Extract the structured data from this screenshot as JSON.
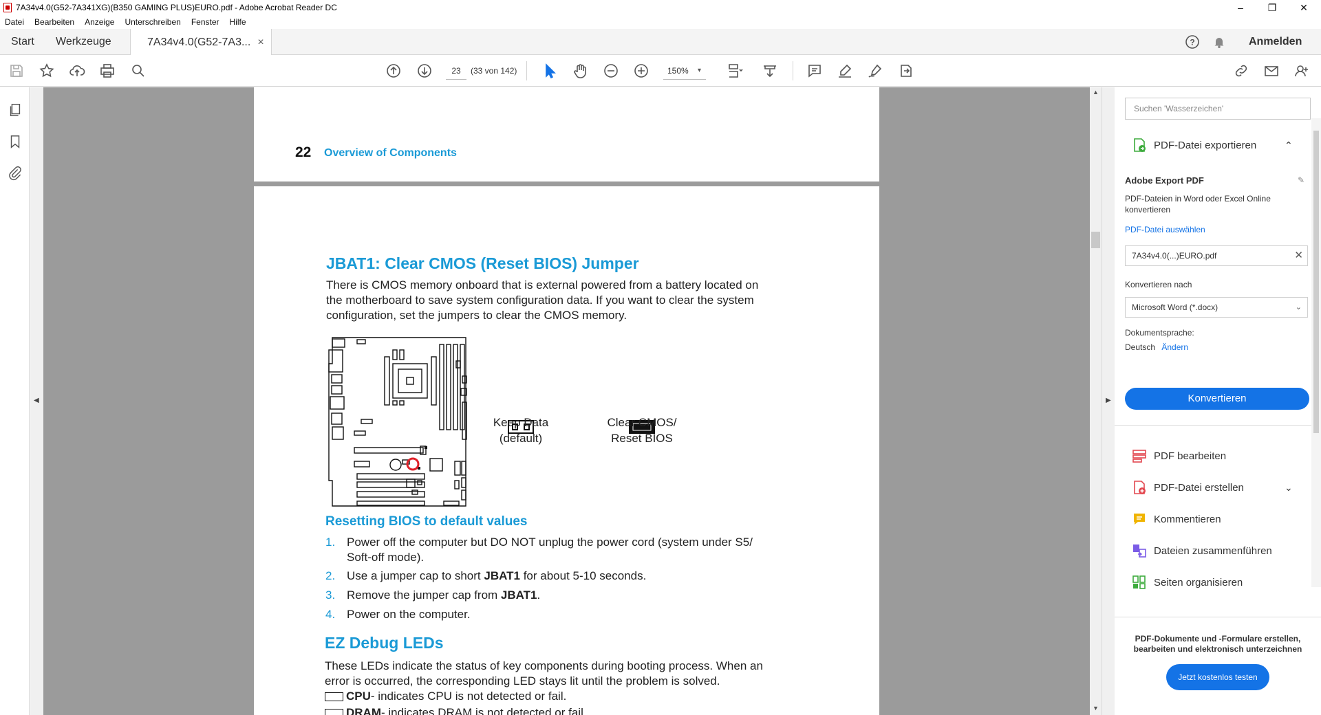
{
  "window": {
    "title": "7A34v4.0(G52-7A341XG)(B350 GAMING PLUS)EURO.pdf - Adobe Acrobat Reader DC"
  },
  "menu": [
    "Datei",
    "Bearbeiten",
    "Anzeige",
    "Unterschreiben",
    "Fenster",
    "Hilfe"
  ],
  "tabs": {
    "home": "Start",
    "tools": "Werkzeuge",
    "document": "7A34v4.0(G52-7A3...",
    "signin": "Anmelden"
  },
  "toolbar": {
    "page_current": "23",
    "page_count": "(33 von 142)",
    "zoom": "150%"
  },
  "document": {
    "page_number": "22",
    "header_title": "Overview of Components",
    "jbat_heading": "JBAT1: Clear CMOS (Reset BIOS) Jumper",
    "jbat_para_lines": [
      "There is CMOS memory onboard that is external powered from a battery located on",
      "the motherboard to save system configuration data. If you want to clear the system",
      "configuration, set the jumpers to clear the CMOS memory."
    ],
    "keep_data_line1": "Keep Data",
    "keep_data_line2": "(default)",
    "clear_cmos_line1": "Clear CMOS/",
    "clear_cmos_line2": "Reset BIOS",
    "reset_heading": "Resetting BIOS to default values",
    "steps": [
      {
        "n": "1.",
        "line1": "Power off the computer but DO NOT unplug the power cord (system under S5/",
        "line2": "Soft-off mode)."
      },
      {
        "n": "2.",
        "pre": "Use a jumper cap to short ",
        "bold": "JBAT1",
        "post": " for about 5-10 seconds."
      },
      {
        "n": "3.",
        "pre": "Remove the jumper cap from ",
        "bold": "JBAT1",
        "post": "."
      },
      {
        "n": "4.",
        "pre": "Power on the computer.",
        "bold": "",
        "post": ""
      }
    ],
    "ez_heading": "EZ Debug LEDs",
    "ez_para_lines": [
      "These LEDs indicate the status of key components during booting process. When an",
      "error is occurred, the corresponding LED stays lit until the problem is solved."
    ],
    "led_cpu_bold": "CPU",
    "led_cpu_text": " - indicates CPU is not detected or fail.",
    "led_dram_bold": "DRAM",
    "led_dram_text": " - indicates DRAM is not detected or fail."
  },
  "panel": {
    "search_placeholder": "Suchen 'Wasserzeichen'",
    "export_title": "PDF-Datei exportieren",
    "adobe_export": "Adobe Export PDF",
    "export_desc_line1": "PDF-Dateien in Word oder Excel Online",
    "export_desc_line2": "konvertieren",
    "select_file": "PDF-Datei auswählen",
    "file_name": "7A34v4.0(...)EURO.pdf",
    "convert_to": "Konvertieren nach",
    "format": "Microsoft Word (*.docx)",
    "doc_lang": "Dokumentsprache:",
    "lang": "Deutsch",
    "change": "Ändern",
    "convert_btn": "Konvertieren",
    "tools": [
      {
        "label": "PDF bearbeiten",
        "icon": "edit-pdf-icon",
        "color": "#e34850"
      },
      {
        "label": "PDF-Datei erstellen",
        "icon": "create-pdf-icon",
        "color": "#e34850"
      },
      {
        "label": "Kommentieren",
        "icon": "comment-icon",
        "color": "#f0b400"
      },
      {
        "label": "Dateien zusammenführen",
        "icon": "combine-files-icon",
        "color": "#7b5ce6"
      },
      {
        "label": "Seiten organisieren",
        "icon": "organize-pages-icon",
        "color": "#3dab3d"
      }
    ],
    "promo_line1": "PDF-Dokumente und -Formulare erstellen,",
    "promo_line2": "bearbeiten und elektronisch unterzeichnen",
    "try_btn": "Jetzt kostenlos testen"
  }
}
